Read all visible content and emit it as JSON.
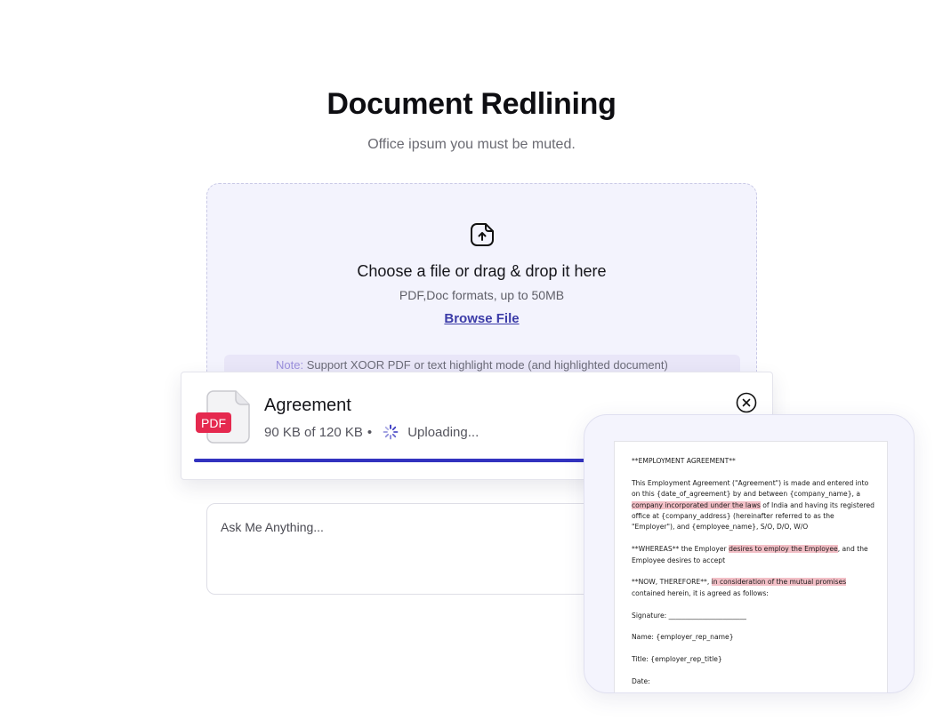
{
  "header": {
    "title": "Document Redlining",
    "subtitle": "Office ipsum you must be muted."
  },
  "dropzone": {
    "icon": "file-upload-icon",
    "title": "Choose a file or drag & drop it here",
    "formats": "PDF,Doc formats, up to 50MB",
    "browse_label": "Browse File",
    "note_label": "Note:",
    "note_text": "Support XOOR PDF or text highlight mode (and highlighted document)"
  },
  "upload": {
    "file_icon_label": "PDF",
    "file_name": "Agreement",
    "size_progress": "90 KB of 120 KB",
    "separator": "•",
    "status": "Uploading...",
    "progress_fraction": 0.75,
    "accent_color": "#3232bf",
    "pdf_badge_color": "#e5294f"
  },
  "ask": {
    "placeholder": "Ask Me Anything..."
  },
  "preview": {
    "heading": "**EMPLOYMENT AGREEMENT**",
    "p1_a": "This Employment Agreement (\"Agreement\") is made and entered into on this {date_of_agreement} by and between {company_name}, a ",
    "p1_hl": "company incorporated under the laws",
    "p1_b": " of India and having its registered office at {company_address} (hereinafter referred to as the \"Employer\"), and {employee_name}, S/O, D/O, W/O",
    "p2_a": "**WHEREAS** the Employer ",
    "p2_hl": "desires to employ the Employee",
    "p2_b": ", and the Employee desires to accept",
    "p3_a": "**NOW, THEREFORE**, ",
    "p3_hl": "in consideration of the mutual promises",
    "p3_b": " contained herein, it is agreed as follows:",
    "signature": "Signature: _______________________",
    "name": "Name: {employer_rep_name}",
    "title": "Title: {employer_rep_title}",
    "date": "Date:",
    "highlight_color": "#f3c0c7"
  }
}
